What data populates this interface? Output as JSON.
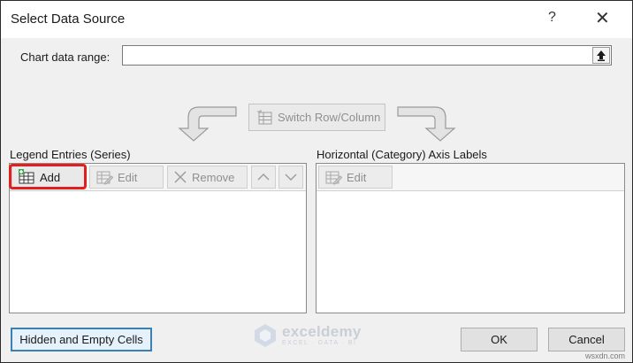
{
  "dialog": {
    "title": "Select Data Source",
    "help_glyph": "?",
    "close_glyph": "✕"
  },
  "range": {
    "label": "Chart data range:",
    "value": ""
  },
  "switch_label": "Switch Row/Column",
  "legend": {
    "label": "Legend Entries (Series)",
    "add": "Add",
    "edit": "Edit",
    "remove": "Remove",
    "items": []
  },
  "axis": {
    "label": "Horizontal (Category) Axis Labels",
    "edit": "Edit",
    "items": []
  },
  "footer": {
    "hidden_cells": "Hidden and Empty Cells",
    "ok": "OK",
    "cancel": "Cancel"
  },
  "logo": {
    "name": "exceldemy",
    "tagline": "EXCEL · DATA · BI"
  },
  "watermark": "wsxdn.com",
  "colors": {
    "highlight": "#e0201e",
    "default_button_border": "#3c7fb1",
    "dialog_background": "#f0f0f0"
  },
  "icons": {
    "collapse": "upload-arrow-icon",
    "add": "table-add-icon",
    "edit": "table-edit-icon",
    "remove": "x-icon",
    "move_up": "chevron-up-icon",
    "move_down": "chevron-down-icon",
    "switch": "switch-icon"
  }
}
